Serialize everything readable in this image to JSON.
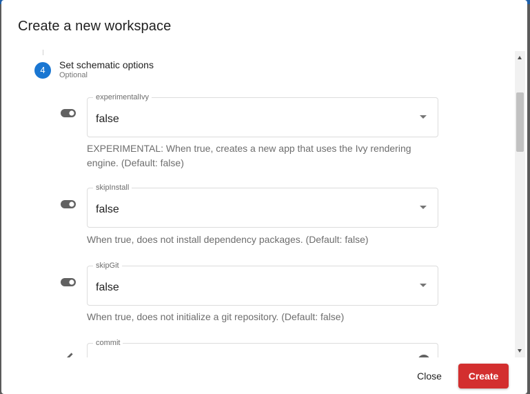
{
  "dialog": {
    "title": "Create a new workspace"
  },
  "step": {
    "number": "4",
    "label": "Set schematic options",
    "sublabel": "Optional"
  },
  "options": [
    {
      "label": "experimentalIvy",
      "value": "false",
      "hint": "EXPERIMENTAL: When true, creates a new app that uses the Ivy rendering engine. (Default: false)",
      "icon": "toggle-icon"
    },
    {
      "label": "skipInstall",
      "value": "false",
      "hint": "When true, does not install dependency packages. (Default: false)",
      "icon": "toggle-icon"
    },
    {
      "label": "skipGit",
      "value": "false",
      "hint": "When true, does not initialize a git repository. (Default: false)",
      "icon": "toggle-icon"
    },
    {
      "label": "commit",
      "icon": "pencil-icon"
    }
  ],
  "actions": {
    "close_label": "Close",
    "create_label": "Create"
  },
  "colors": {
    "accent": "#1976d2",
    "create": "#d32f2f",
    "header_strip": "#1e5fa8"
  }
}
